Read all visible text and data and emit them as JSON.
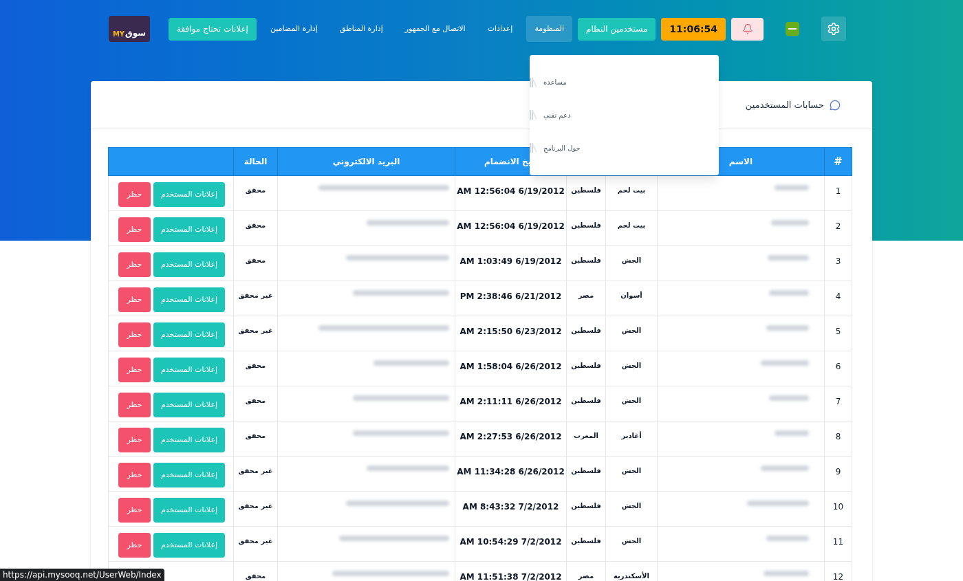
{
  "logo": {
    "latin": "MY",
    "arabic": "سوق"
  },
  "nav": [
    {
      "kind": "icon-button",
      "selected": false
    },
    {
      "kind": "flag",
      "selected": false
    },
    {
      "kind": "bell",
      "selected": false
    },
    {
      "kind": "clock",
      "label": "11:06:54",
      "selected": false
    },
    {
      "kind": "button",
      "label": "مستخدمين النظام",
      "selected": false
    },
    {
      "kind": "link",
      "label": "المنظومة",
      "selected": true
    },
    {
      "kind": "link",
      "label": "إعدادات",
      "selected": false
    },
    {
      "kind": "link",
      "label": "الاتصال مع الجمهور",
      "selected": false
    },
    {
      "kind": "link",
      "label": "إدارة المناطق",
      "selected": false
    },
    {
      "kind": "link",
      "label": "إدارة المضامين",
      "selected": false
    },
    {
      "kind": "button",
      "label": "إعلانات تحتاج موافقة",
      "selected": false
    }
  ],
  "dropdown": {
    "items": [
      "مساعده",
      "دعم تقني",
      "حول البرنامج"
    ]
  },
  "card": {
    "title": "حسابات المستخدمين"
  },
  "table": {
    "columns": [
      "#",
      "الاسم",
      "",
      "",
      "يخ الانضمام",
      "البريد الالكتروني",
      "الحالة",
      ""
    ],
    "rows": [
      {
        "index": "1",
        "city": "بيت لحم",
        "country": "فلسطين",
        "joined": "AM 12:56:04 6/19/2012",
        "status": "محقق",
        "actions": [
          "إعلانات المستخدم",
          "حظر"
        ]
      },
      {
        "index": "2",
        "city": "بيت لحم",
        "country": "فلسطين",
        "joined": "AM 12:56:04 6/19/2012",
        "status": "محقق",
        "actions": [
          "إعلانات المستخدم",
          "حظر"
        ]
      },
      {
        "index": "3",
        "city": "الجش",
        "country": "فلسطين",
        "joined": "AM 1:03:49 6/19/2012",
        "status": "محقق",
        "actions": [
          "إعلانات المستخدم",
          "حظر"
        ]
      },
      {
        "index": "4",
        "city": "أسوان",
        "country": "مصر",
        "joined": "PM 2:38:46 6/21/2012",
        "status": "غير محقق",
        "actions": [
          "إعلانات المستخدم",
          "حظر"
        ]
      },
      {
        "index": "5",
        "city": "الجش",
        "country": "فلسطين",
        "joined": "AM 2:15:50 6/23/2012",
        "status": "غير محقق",
        "actions": [
          "إعلانات المستخدم",
          "حظر"
        ]
      },
      {
        "index": "6",
        "city": "الجش",
        "country": "فلسطين",
        "joined": "AM 1:58:04 6/26/2012",
        "status": "محقق",
        "actions": [
          "إعلانات المستخدم",
          "حظر"
        ]
      },
      {
        "index": "7",
        "city": "الجش",
        "country": "فلسطين",
        "joined": "AM 2:11:11 6/26/2012",
        "status": "محقق",
        "actions": [
          "إعلانات المستخدم",
          "حظر"
        ]
      },
      {
        "index": "8",
        "city": "أغادير",
        "country": "المغرب",
        "joined": "AM 2:27:53 6/26/2012",
        "status": "محقق",
        "actions": [
          "إعلانات المستخدم",
          "حظر"
        ]
      },
      {
        "index": "9",
        "city": "الجش",
        "country": "فلسطين",
        "joined": "AM 11:34:28 6/26/2012",
        "status": "غير محقق",
        "actions": [
          "إعلانات المستخدم",
          "حظر"
        ]
      },
      {
        "index": "10",
        "city": "الجش",
        "country": "فلسطين",
        "joined": "AM 8:43:32 7/2/2012",
        "status": "غير محقق",
        "actions": [
          "إعلانات المستخدم",
          "حظر"
        ]
      },
      {
        "index": "11",
        "city": "الجش",
        "country": "فلسطين",
        "joined": "AM 10:54:29 7/2/2012",
        "status": "غير محقق",
        "actions": [
          "إعلانات المستخدم",
          "حظر"
        ]
      },
      {
        "index": "12",
        "city": "الأسكندرية",
        "country": "مصر",
        "joined": "AM 11:51:38 7/2/2012",
        "status": "محقق"
      }
    ]
  },
  "status_bar": {
    "url": "https://api.mysooq.net/UserWeb/Index"
  }
}
